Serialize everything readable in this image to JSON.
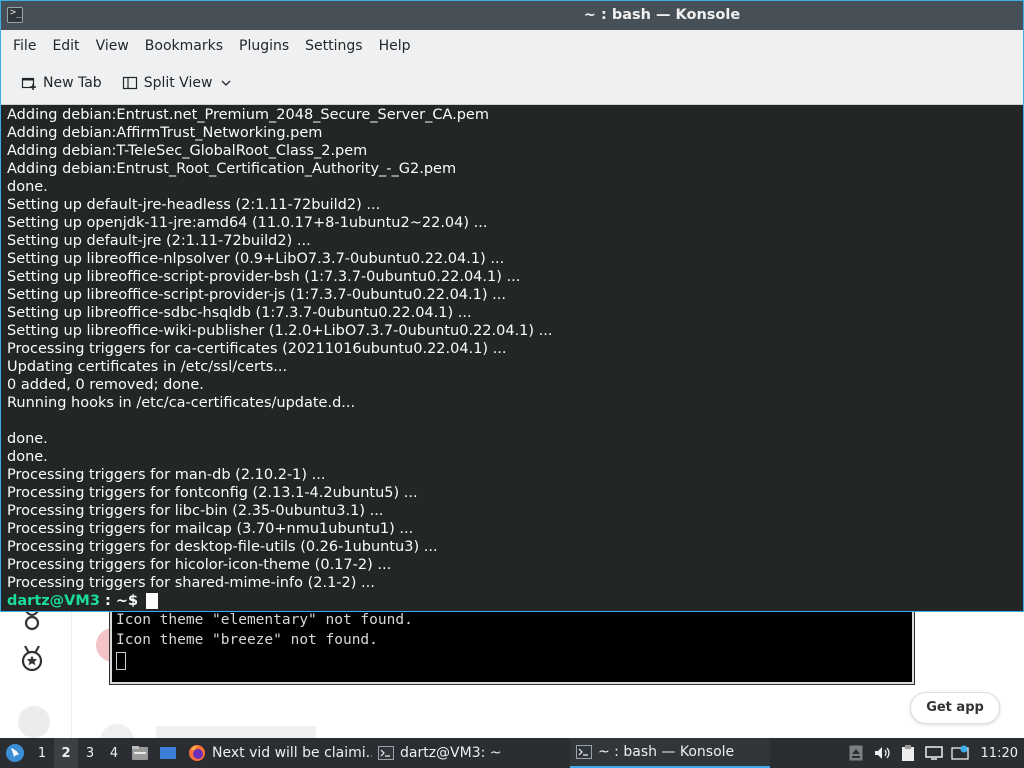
{
  "window": {
    "title": "~ : bash — Konsole"
  },
  "menu": [
    "File",
    "Edit",
    "View",
    "Bookmarks",
    "Plugins",
    "Settings",
    "Help"
  ],
  "toolbar": {
    "new_tab": "New Tab",
    "split_view": "Split View"
  },
  "terminal": {
    "lines": [
      "Adding debian:Entrust.net_Premium_2048_Secure_Server_CA.pem",
      "Adding debian:AffirmTrust_Networking.pem",
      "Adding debian:T-TeleSec_GlobalRoot_Class_2.pem",
      "Adding debian:Entrust_Root_Certification_Authority_-_G2.pem",
      "done.",
      "Setting up default-jre-headless (2:1.11-72build2) ...",
      "Setting up openjdk-11-jre:amd64 (11.0.17+8-1ubuntu2~22.04) ...",
      "Setting up default-jre (2:1.11-72build2) ...",
      "Setting up libreoffice-nlpsolver (0.9+LibO7.3.7-0ubuntu0.22.04.1) ...",
      "Setting up libreoffice-script-provider-bsh (1:7.3.7-0ubuntu0.22.04.1) ...",
      "Setting up libreoffice-script-provider-js (1:7.3.7-0ubuntu0.22.04.1) ...",
      "Setting up libreoffice-sdbc-hsqldb (1:7.3.7-0ubuntu0.22.04.1) ...",
      "Setting up libreoffice-wiki-publisher (1.2.0+LibO7.3.7-0ubuntu0.22.04.1) ...",
      "Processing triggers for ca-certificates (20211016ubuntu0.22.04.1) ...",
      "Updating certificates in /etc/ssl/certs...",
      "0 added, 0 removed; done.",
      "Running hooks in /etc/ca-certificates/update.d...",
      "",
      "done.",
      "done.",
      "Processing triggers for man-db (2.10.2-1) ...",
      "Processing triggers for fontconfig (2.13.1-4.2ubuntu5) ...",
      "Processing triggers for libc-bin (2.35-0ubuntu3.1) ...",
      "Processing triggers for mailcap (3.70+nmu1ubuntu1) ...",
      "Processing triggers for desktop-file-utils (0.26-1ubuntu3) ...",
      "Processing triggers for hicolor-icon-theme (0.17-2) ...",
      "Processing triggers for shared-mime-info (2.1-2) ..."
    ],
    "prompt_user": "dartz@VM3",
    "prompt_path": " : ~$"
  },
  "background": {
    "terminal_lines": [
      "Icon theme \"elementary\" not found.",
      "Icon theme \"breeze\" not found."
    ],
    "get_app": "Get app"
  },
  "taskbar": {
    "desktops": [
      "1",
      "2",
      "3",
      "4"
    ],
    "active_desktop": "2",
    "tasks": [
      {
        "label": "Next vid will be claimi...",
        "icon": "firefox-icon"
      },
      {
        "label": "dartz@VM3: ~",
        "icon": "terminal-icon"
      },
      {
        "label": "~ : bash — Konsole",
        "icon": "terminal-icon"
      }
    ],
    "clock": "11:20"
  },
  "colors": {
    "accent": "#3daee9",
    "terminal_bg": "#232627",
    "prompt_green": "#1cdc9a"
  }
}
